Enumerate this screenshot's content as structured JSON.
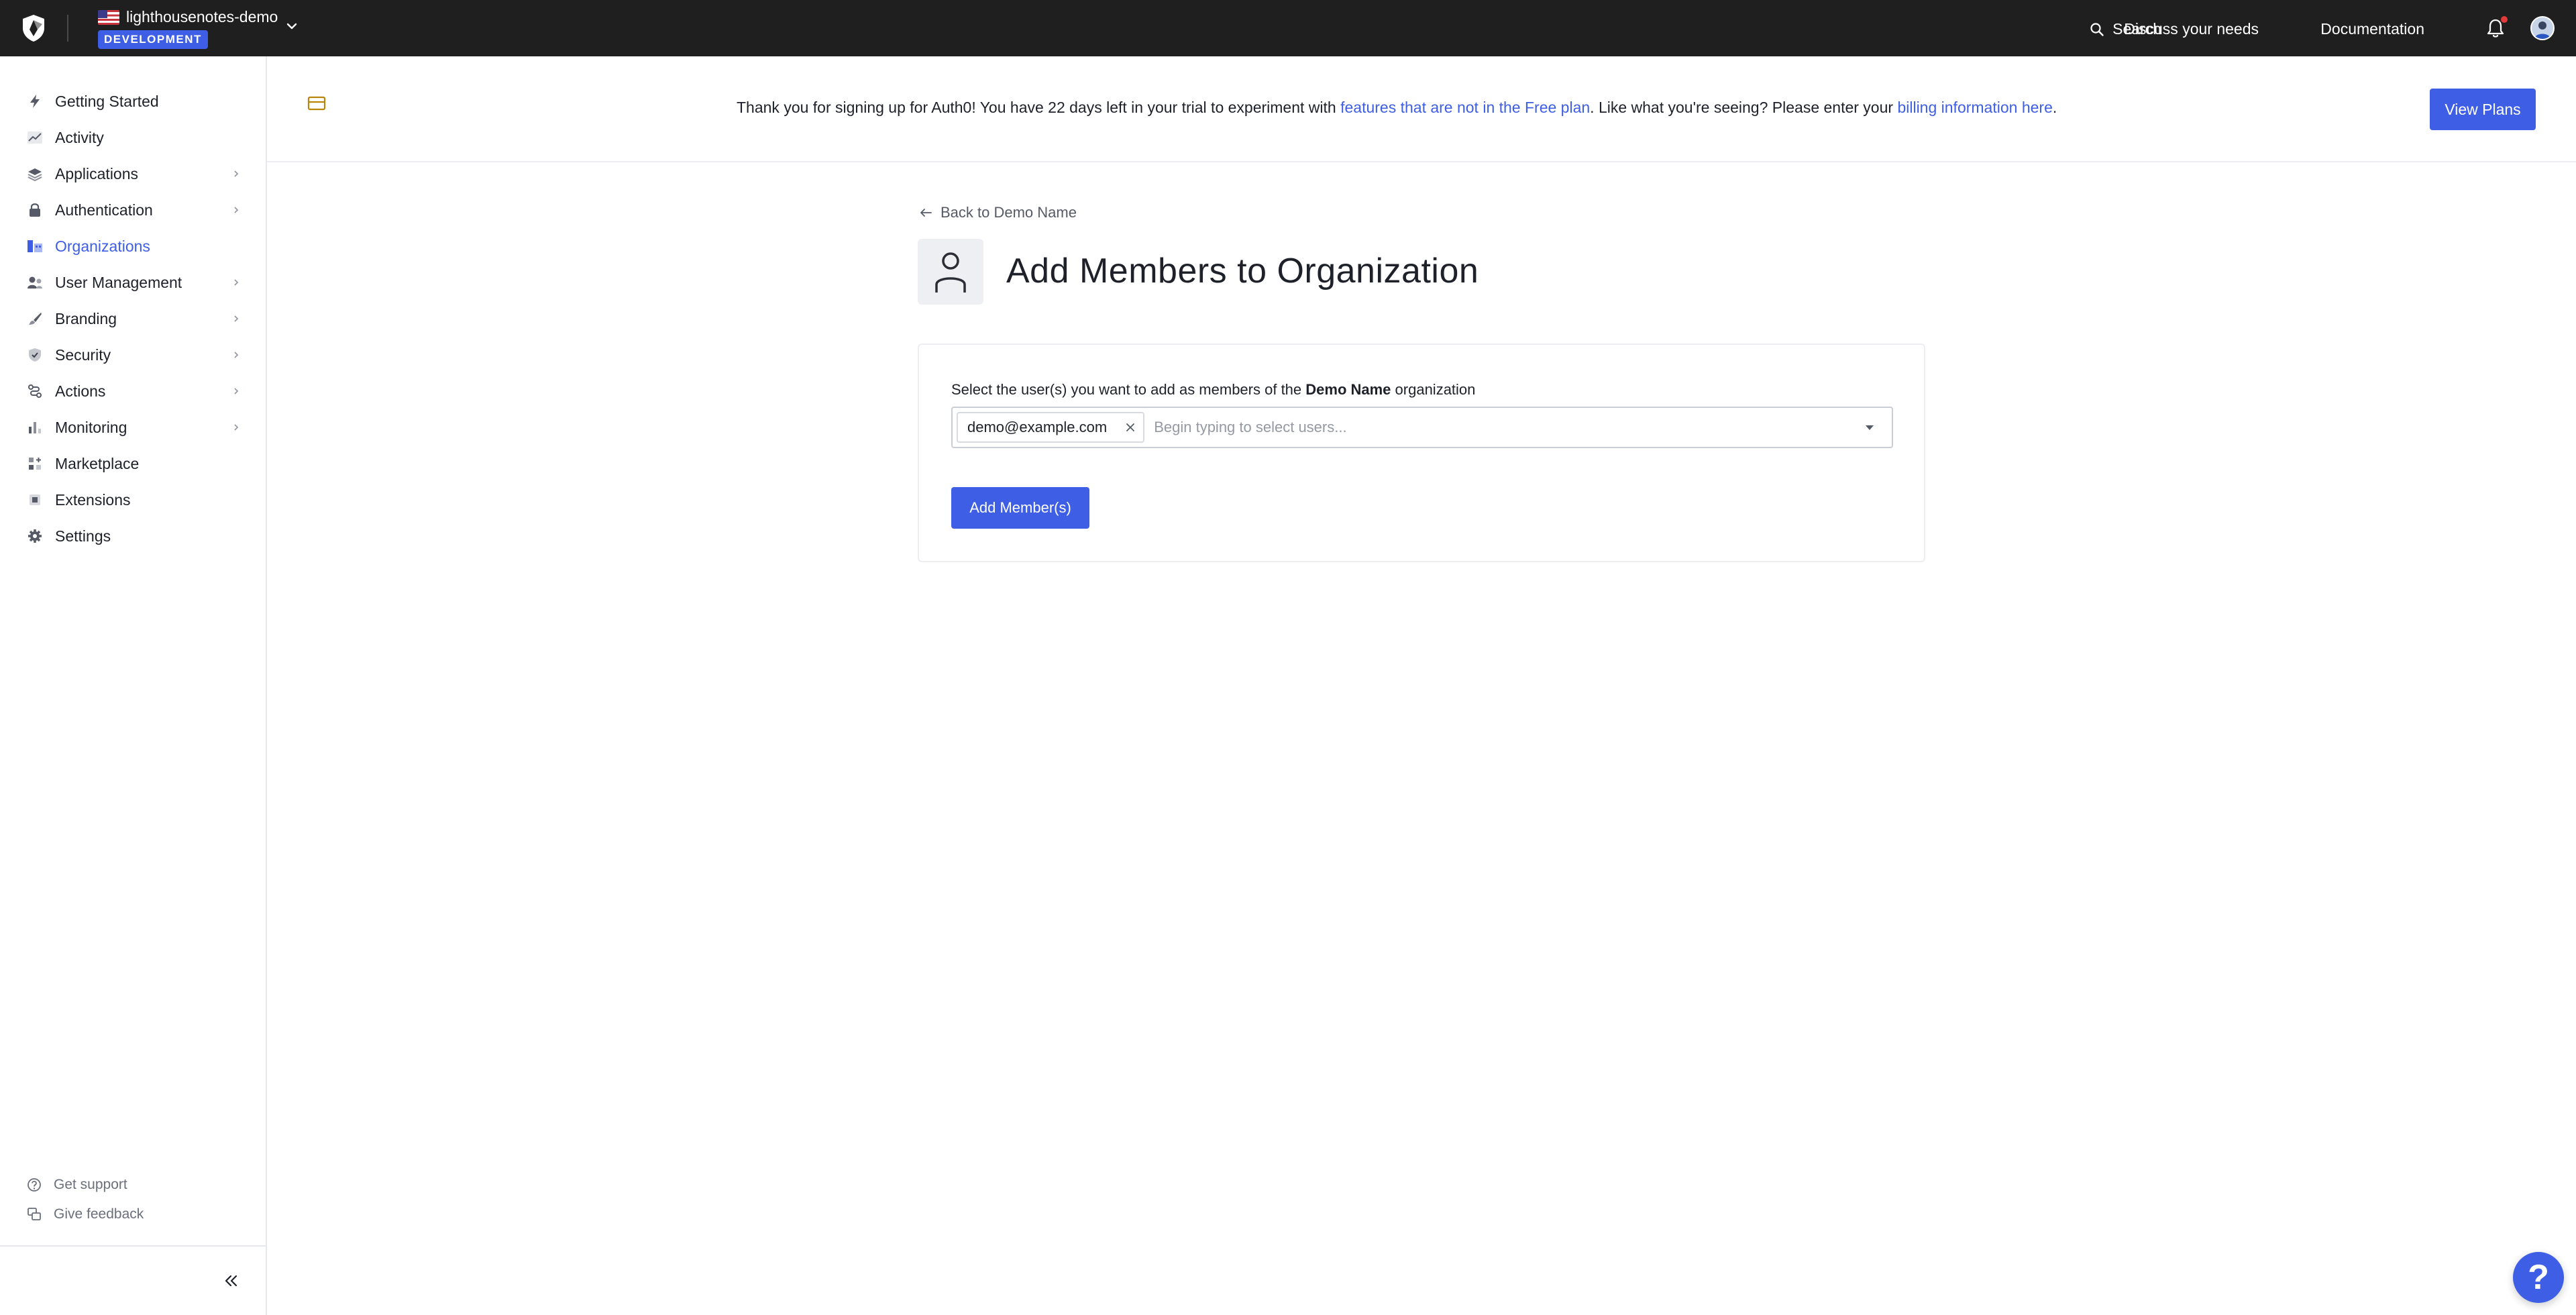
{
  "topbar": {
    "tenant_name": "lighthousenotes-demo",
    "environment": "DEVELOPMENT",
    "search_label": "Search",
    "discuss_label": "Discuss your needs",
    "docs_label": "Documentation",
    "logo_icon": "auth0-shield-icon",
    "notification_icon": "bell-icon",
    "accent_color": "#3e5ee6"
  },
  "sidebar": {
    "items": [
      {
        "label": "Getting Started",
        "icon": "lightning-icon",
        "has_children": false
      },
      {
        "label": "Activity",
        "icon": "activity-chart-icon",
        "has_children": false
      },
      {
        "label": "Applications",
        "icon": "layers-icon",
        "has_children": true
      },
      {
        "label": "Authentication",
        "icon": "lock-icon",
        "has_children": true
      },
      {
        "label": "Organizations",
        "icon": "building-icon",
        "has_children": false,
        "active": true
      },
      {
        "label": "User Management",
        "icon": "users-icon",
        "has_children": true
      },
      {
        "label": "Branding",
        "icon": "brush-icon",
        "has_children": true
      },
      {
        "label": "Security",
        "icon": "shield-check-icon",
        "has_children": true
      },
      {
        "label": "Actions",
        "icon": "flow-icon",
        "has_children": true
      },
      {
        "label": "Monitoring",
        "icon": "bar-chart-icon",
        "has_children": true
      },
      {
        "label": "Marketplace",
        "icon": "grid-plus-icon",
        "has_children": false
      },
      {
        "label": "Extensions",
        "icon": "chip-icon",
        "has_children": false
      },
      {
        "label": "Settings",
        "icon": "gear-icon",
        "has_children": false
      }
    ],
    "footer": {
      "support_label": "Get support",
      "feedback_label": "Give feedback"
    }
  },
  "banner": {
    "text_before": "Thank you for signing up for Auth0! You have 22 days left in your trial to experiment with ",
    "link1": "features that are not in the Free plan",
    "text_middle": ". Like what you're seeing? Please enter your ",
    "link2": "billing information here",
    "text_after": ".",
    "button_label": "View Plans"
  },
  "main": {
    "back_label": "Back to Demo Name",
    "title": "Add Members to Organization",
    "form": {
      "label_before": "Select the user(s) you want to add as members of the ",
      "org_name": "Demo Name",
      "label_after": " organization",
      "selected_user": "demo@example.com",
      "placeholder": "Begin typing to select users...",
      "submit_label": "Add Member(s)"
    },
    "help_label": "?"
  }
}
